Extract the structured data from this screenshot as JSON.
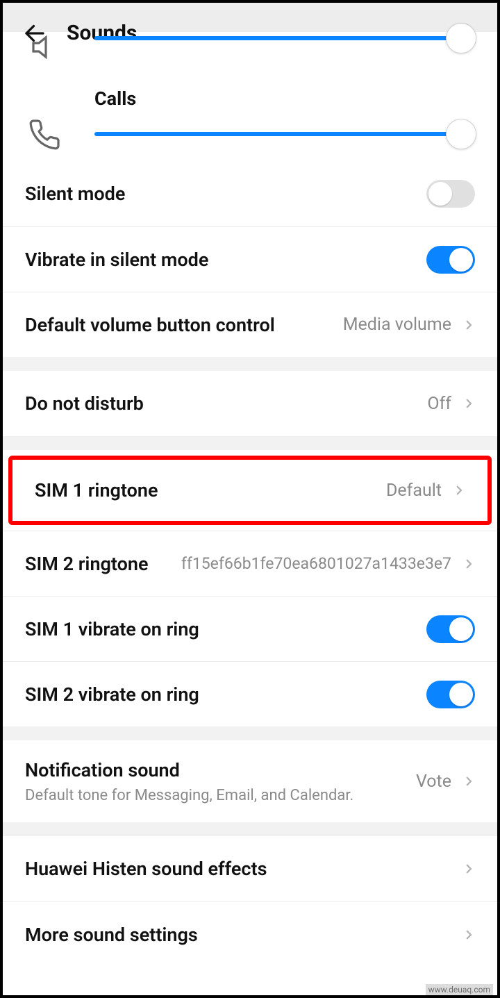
{
  "header": {
    "title": "Sounds"
  },
  "sliders": {
    "calls": {
      "label": "Calls"
    }
  },
  "section1": {
    "silent_mode": {
      "label": "Silent mode",
      "on": false
    },
    "vibrate_silent": {
      "label": "Vibrate in silent mode",
      "on": true
    },
    "default_volume_btn": {
      "label": "Default volume button control",
      "value": "Media volume"
    }
  },
  "section2": {
    "dnd": {
      "label": "Do not disturb",
      "value": "Off"
    }
  },
  "section3": {
    "sim1_ringtone": {
      "label": "SIM 1 ringtone",
      "value": "Default"
    },
    "sim2_ringtone": {
      "label": "SIM 2 ringtone",
      "value": "ff15ef66b1fe70ea6801027a1433e3e7"
    },
    "sim1_vibrate": {
      "label": "SIM 1 vibrate on ring",
      "on": true
    },
    "sim2_vibrate": {
      "label": "SIM 2 vibrate on ring",
      "on": true
    }
  },
  "section4": {
    "notification_sound": {
      "label": "Notification sound",
      "subtitle": "Default tone for Messaging, Email, and Calendar.",
      "value": "Vote"
    }
  },
  "section5": {
    "histen": {
      "label": "Huawei Histen sound effects"
    },
    "more": {
      "label": "More sound settings"
    }
  },
  "watermark": "www.deuaq.com"
}
